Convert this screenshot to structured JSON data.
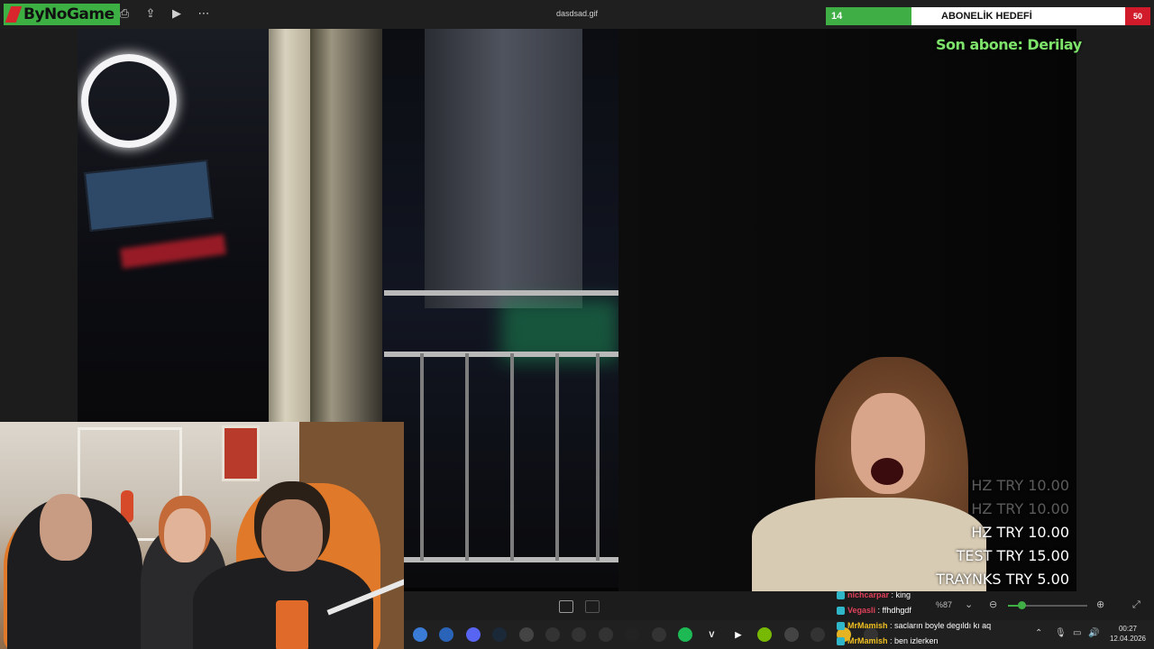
{
  "titlebar": {
    "logo_text": "ByNoGame",
    "filename": "dasdsad.gif",
    "icons": [
      "crop-icon",
      "print-icon",
      "share-icon",
      "slideshow-icon",
      "more-icon"
    ]
  },
  "sub_goal": {
    "label": "ABONELİK HEDEFİ",
    "current": "14",
    "total": "50",
    "progress_fraction": 0.28
  },
  "overlay": {
    "last_sub": "Son abone: Derilay",
    "donations": [
      {
        "name": "HZ",
        "amount": "TRY 10.00",
        "faded": true
      },
      {
        "name": "HZ",
        "amount": "TRY 10.00",
        "faded": true
      },
      {
        "name": "HZ",
        "amount": "TRY 10.00",
        "faded": false
      },
      {
        "name": "TEST",
        "amount": "TRY 15.00",
        "faded": false
      },
      {
        "name": "TRAYNKS",
        "amount": "TRY 5.00",
        "faded": false
      }
    ]
  },
  "zoom": {
    "level": "%87",
    "level_fraction": 0.18
  },
  "chat": [
    {
      "user": "nichcarpar",
      "color": "#e0405a",
      "msg": "king"
    },
    {
      "user": "Vegasli",
      "color": "#e0405a",
      "msg": "ffhdhgdf"
    },
    {
      "user": "MrMamish",
      "color": "#f0c020",
      "msg": "sacların boyle degıldı kı aq"
    },
    {
      "user": "MrMamish",
      "color": "#f0c020",
      "msg": "ben izlerken"
    }
  ],
  "taskbar": {
    "apps": [
      {
        "name": "circle-app-icon",
        "color": "#3a7bd5",
        "glyph": ""
      },
      {
        "name": "globe-icon",
        "color": "#2a64b8",
        "glyph": ""
      },
      {
        "name": "discord-icon",
        "color": "#5865f2",
        "glyph": ""
      },
      {
        "name": "steam-icon",
        "color": "#1b2838",
        "glyph": ""
      },
      {
        "name": "game-controller-icon",
        "color": "#444",
        "glyph": ""
      },
      {
        "name": "obs-icon",
        "color": "#333",
        "glyph": ""
      },
      {
        "name": "disc-icon",
        "color": "#333",
        "glyph": ""
      },
      {
        "name": "search-ring-icon",
        "color": "#333",
        "glyph": ""
      },
      {
        "name": "epic-games-icon",
        "color": "#222",
        "glyph": ""
      },
      {
        "name": "cube-icon",
        "color": "#333",
        "glyph": ""
      },
      {
        "name": "spotify-icon",
        "color": "#1db954",
        "glyph": ""
      },
      {
        "name": "v-app-icon",
        "color": "#202020",
        "glyph": "V"
      },
      {
        "name": "play-arrow-icon",
        "color": "#202020",
        "glyph": "▶"
      },
      {
        "name": "nvidia-icon",
        "color": "#76b900",
        "glyph": ""
      },
      {
        "name": "record-icon",
        "color": "#444",
        "glyph": ""
      },
      {
        "name": "clock-app-icon",
        "color": "#333",
        "glyph": ""
      },
      {
        "name": "folder-icon",
        "color": "#e6b422",
        "glyph": ""
      },
      {
        "name": "terminal-icon",
        "color": "#333",
        "glyph": ""
      }
    ],
    "time": "00:27",
    "date": "12.04.2026"
  }
}
